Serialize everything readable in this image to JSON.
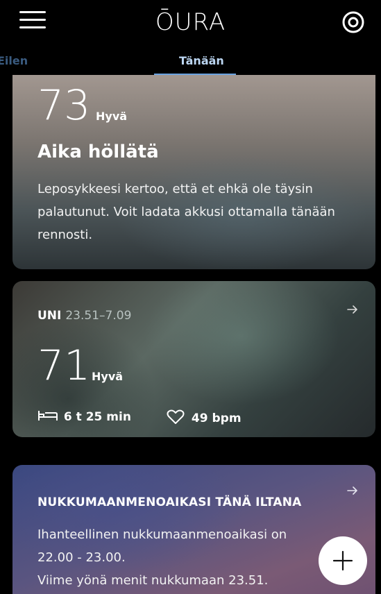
{
  "header": {
    "logo_text": "ŌURA",
    "menu_icon": "hamburger-menu-icon",
    "ring_icon": "ring-icon"
  },
  "tabs": {
    "yesterday": "Eilen",
    "today": "Tänään"
  },
  "readiness": {
    "score": "73",
    "score_label": "Hyvä",
    "heading": "Aika höllätä",
    "body": "Leposykkeesi kertoo, että et ehkä ole täysin palautunut. Voit ladata akkusi ottamalla tänään rennosti."
  },
  "sleep": {
    "title": "UNI",
    "time_range": "23.51–7.09",
    "score": "71",
    "score_label": "Hyvä",
    "duration": "6 t 25 min",
    "heart_rate": "49 bpm",
    "arrow_icon": "arrow-right-icon",
    "bed_icon": "bed-icon",
    "heart_icon": "heart-icon"
  },
  "bedtime": {
    "title": "NUKKUMAANMENOAIKASI TÄNÄ ILTANA",
    "line1": "Ihanteellinen nukkumaanmenoaikasi on",
    "line2": "22.00 - 23.00.",
    "line3": "Viime yönä menit nukkumaan 23.51.",
    "arrow_icon": "arrow-right-icon"
  },
  "fab": {
    "icon": "plus-icon"
  },
  "colors": {
    "background": "#000000",
    "tab_active": "#bcd6f2",
    "tab_underline": "#6aa3e0",
    "tab_inactive": "#3a5b80"
  }
}
